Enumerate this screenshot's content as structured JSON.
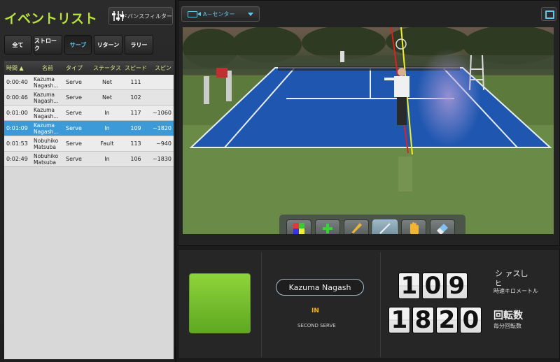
{
  "event_list": {
    "title": "イベントリスト",
    "advanced_filter_label": "アドバンスフィルター",
    "filters": [
      {
        "label": "全て",
        "active": false
      },
      {
        "label": "ストローク",
        "active": false
      },
      {
        "label": "サーブ",
        "active": true
      },
      {
        "label": "リターン",
        "active": false
      },
      {
        "label": "ラリー",
        "active": false
      }
    ],
    "columns": [
      "時間 ▲",
      "名前",
      "タイプ",
      "ステータス",
      "スピード",
      "スピン"
    ],
    "rows": [
      {
        "time": "0:00:40",
        "name": "Kazuma Nagash...",
        "type": "Serve",
        "status": "Net",
        "speed": "111",
        "spin": ""
      },
      {
        "time": "0:00:46",
        "name": "Kazuma Nagash...",
        "type": "Serve",
        "status": "Net",
        "speed": "102",
        "spin": ""
      },
      {
        "time": "0:01:00",
        "name": "Kazuma Nagash...",
        "type": "Serve",
        "status": "In",
        "speed": "117",
        "spin": "~1060"
      },
      {
        "time": "0:01:09",
        "name": "Kazuma Nagash...",
        "type": "Serve",
        "status": "In",
        "speed": "109",
        "spin": "~1820",
        "selected": true
      },
      {
        "time": "0:01:53",
        "name": "Nobuhiko Matsuba",
        "type": "Serve",
        "status": "Fault",
        "speed": "113",
        "spin": "~940"
      },
      {
        "time": "0:02:49",
        "name": "Nobuhiko Matsuba",
        "type": "Serve",
        "status": "In",
        "speed": "106",
        "spin": "~1830"
      }
    ]
  },
  "video": {
    "camera_label": "A－センター",
    "tools": [
      "color-palette-icon",
      "plus-icon",
      "pencil-icon",
      "line-icon",
      "hand-icon",
      "eraser-icon"
    ],
    "active_tool": 3
  },
  "shot_info": {
    "status_color": "#7cc430",
    "player_name": "Kazuma Nagash",
    "result": "IN",
    "serve_type": "SECOND SERVE",
    "speed_digits": [
      "1",
      "0",
      "9"
    ],
    "speed_unit_top": "シ ァス乚",
    "speed_unit_mid": "ヒ",
    "speed_unit_label": "時速キロメートル",
    "spin_digits": [
      "1",
      "8",
      "2",
      "0"
    ],
    "spin_title": "回転数",
    "spin_unit_label": "毎分回転数"
  },
  "colors": {
    "accent_blue": "#5ec8ef",
    "accent_green": "#b7e23c",
    "selected_row": "#3d9ad9",
    "status_in": "#ffb400"
  }
}
